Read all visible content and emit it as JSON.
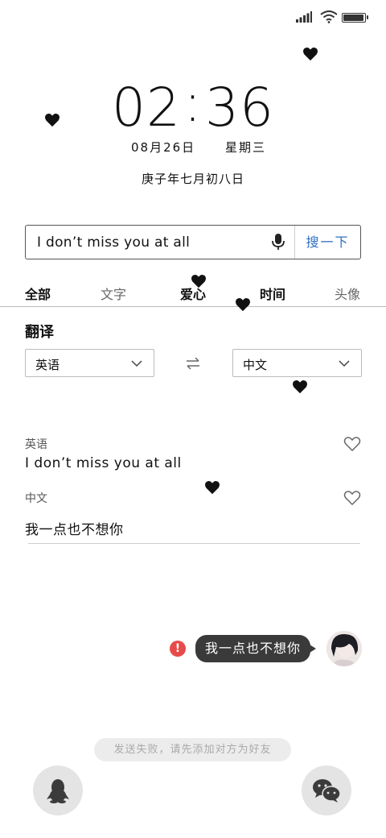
{
  "status": {
    "signal_icon": "signal-bars-icon",
    "wifi_icon": "wifi-icon",
    "battery_icon": "battery-icon",
    "battery_level_percent": 90
  },
  "lockscreen": {
    "hour": "02",
    "colon": ":",
    "minute": "36",
    "date": "08月26日",
    "weekday": "星期三",
    "lunar_date": "庚子年七月初八日"
  },
  "search": {
    "value": "I don’t miss you at all",
    "button_label": "搜一下",
    "mic_icon": "microphone-icon"
  },
  "tabs": [
    {
      "label": "全部",
      "active": true
    },
    {
      "label": "文字",
      "active": false
    },
    {
      "label": "爱心",
      "active": false
    },
    {
      "label": "时间",
      "active": false
    },
    {
      "label": "头像",
      "active": false
    }
  ],
  "translate": {
    "title": "翻译",
    "source_lang": "英语",
    "target_lang": "中文",
    "swap_icon": "swap-arrows-icon",
    "result_source_label": "英语",
    "result_source_text": "I don’t miss you at all",
    "result_target_label": "中文",
    "result_target_text": "我一点也不想你"
  },
  "chat": {
    "message": "我一点也不想你",
    "error_glyph": "!",
    "toast": "发送失败，请先添加对方为好友"
  },
  "bottom": {
    "left_icon": "qq-penguin-icon",
    "right_icon": "wechat-icon"
  },
  "colors": {
    "accent_blue": "#2f6fc1",
    "error_red": "#e84a4a",
    "bubble_dark": "#3a3a3a"
  }
}
